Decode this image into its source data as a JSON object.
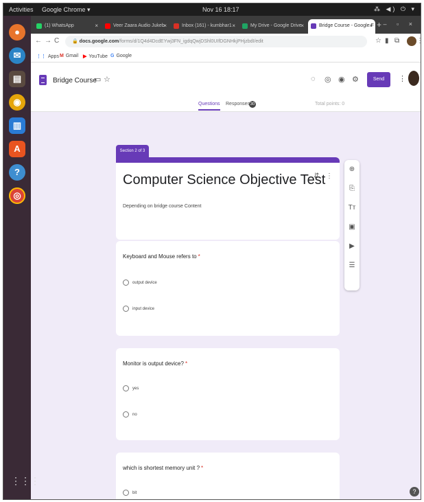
{
  "system": {
    "activities": "Activities",
    "app_menu": "Google Chrome ▾",
    "clock": "Nov 16 18:17",
    "tray": "⁂ ◀) ⏻ ▾"
  },
  "tabs": [
    {
      "label": "(1) WhatsApp",
      "color": "#25d366"
    },
    {
      "label": "Veer Zaara Audio Jukeb",
      "color": "#ff0000"
    },
    {
      "label": "Inbox (161) - kumbhar1",
      "color": "#d93025"
    },
    {
      "label": "My Drive - Google Drive",
      "color": "#1fa463"
    },
    {
      "label": "Bridge Course - Google F",
      "color": "#673ab7"
    }
  ],
  "address": {
    "host": "docs.google.com",
    "path": "/forms/d/1Q4d4DcdEYwj3FN_igdqQwjDShl0UIfDGNHkjPHjzbdI/edit"
  },
  "bookmarks": [
    {
      "icon": "⋮⋮",
      "label": "Apps",
      "color": "#4285f4"
    },
    {
      "icon": "M",
      "label": "Gmail",
      "color": "#d93025"
    },
    {
      "icon": "▶",
      "label": "YouTube",
      "color": "#ff0000"
    },
    {
      "icon": "G",
      "label": "Google",
      "color": "#4285f4"
    }
  ],
  "form": {
    "title": "Bridge Course",
    "send": "Send",
    "tab_questions": "Questions",
    "tab_responses": "Responses",
    "responses_count": "30",
    "total_points": "Total points: 0"
  },
  "section": {
    "tab": "Section 2 of 3",
    "title": "Computer Science Objective Test",
    "description": "Depending on bridge course Content"
  },
  "questions": [
    {
      "text": "Keyboard and Mouse refers to",
      "required": "*",
      "options": [
        "output device",
        "input device"
      ]
    },
    {
      "text": "Monitor is output device?",
      "required": "*",
      "options": [
        "yes",
        "no"
      ]
    },
    {
      "text": "which is shortest memory unit ?",
      "required": "*",
      "options": [
        "bit"
      ]
    }
  ],
  "colors": {
    "accent": "#673ab7",
    "background": "#f0ebf8",
    "required": "#d93025"
  }
}
